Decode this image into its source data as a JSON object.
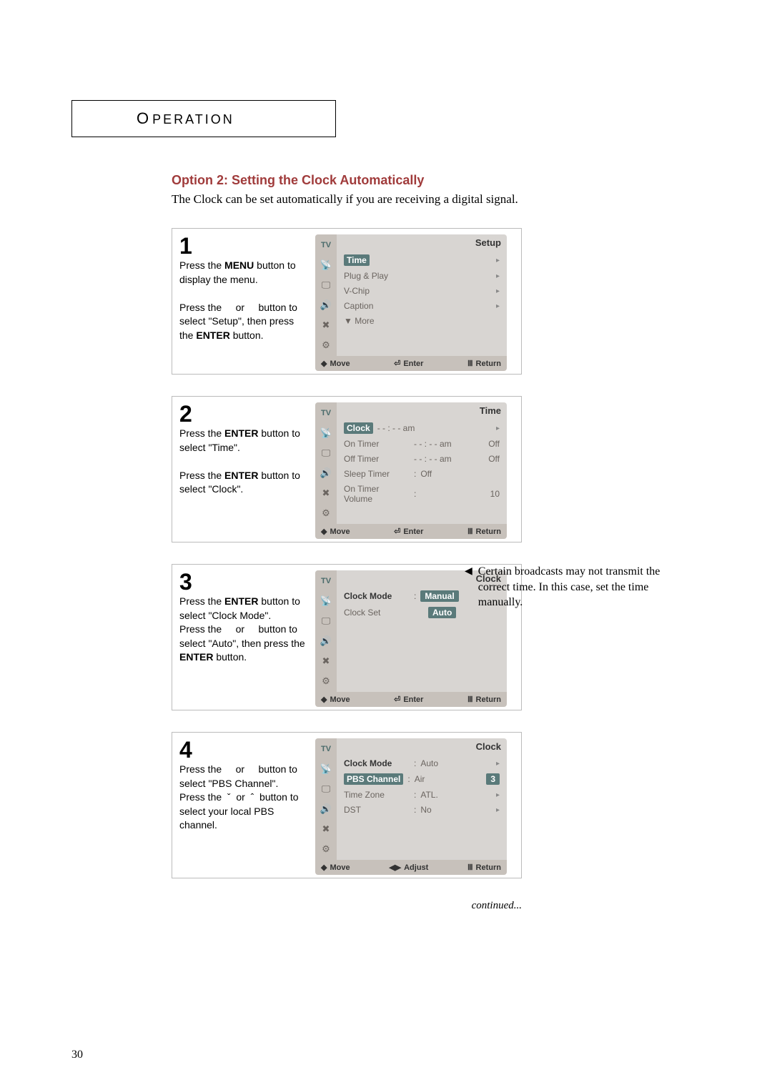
{
  "header": {
    "big": "O",
    "rest": "PERATION"
  },
  "subheading": "Option 2: Setting the Clock Automatically",
  "intro": "The Clock can be set automatically if you are receiving a digital signal.",
  "steps": [
    {
      "num": "1",
      "text_html": "Press the <strong>MENU</strong> button to display the menu.<br><br>Press the &nbsp;&nbsp;&nbsp; or &nbsp;&nbsp;&nbsp; button to select \"Setup\", then press the <strong>ENTER</strong> button.",
      "osd": {
        "title": "Setup",
        "rows": [
          {
            "label": "Time",
            "selected": true,
            "arrow": true
          },
          {
            "label": "Plug & Play",
            "dash": true
          },
          {
            "label": "V-Chip",
            "dash": true
          },
          {
            "label": "Caption",
            "dash": true
          },
          {
            "label": "▼ More",
            "more": true
          }
        ],
        "footer": [
          "Move",
          "Enter",
          "Return"
        ],
        "footer_icons": [
          "updown",
          "enter",
          "return"
        ]
      }
    },
    {
      "num": "2",
      "text_html": "Press the <strong>ENTER</strong> button to select \"Time\".<br><br>Press the <strong>ENTER</strong> button to select \"Clock\".",
      "osd": {
        "title": "Time",
        "rows": [
          {
            "label": "Clock",
            "selected": true,
            "val": "- - : - - am",
            "arrow": true
          },
          {
            "label": "On Timer",
            "val": "- - : - - am",
            "val2": "Off"
          },
          {
            "label": "Off Timer",
            "val": "- - : - - am",
            "val2": "Off"
          },
          {
            "label": "Sleep Timer",
            "colon": true,
            "val": "Off"
          },
          {
            "label": "On Timer Volume",
            "colon": true,
            "val": "10",
            "val_align_right": true
          }
        ],
        "footer": [
          "Move",
          "Enter",
          "Return"
        ],
        "footer_icons": [
          "updown",
          "enter",
          "return"
        ]
      }
    },
    {
      "num": "3",
      "text_html": "Press the <strong>ENTER</strong> button to select \"Clock Mode\".<br>Press the &nbsp;&nbsp;&nbsp; or &nbsp;&nbsp;&nbsp; button to select \"Auto\", then press the <strong>ENTER</strong> button.",
      "osd": {
        "title": "Clock",
        "rows": [
          {
            "label": "Clock Mode",
            "bold": true,
            "colon": true,
            "hl_val": "Manual"
          },
          {
            "label": "Clock Set",
            "hl_val_detached": "Auto"
          }
        ],
        "footer": [
          "Move",
          "Enter",
          "Return"
        ],
        "footer_icons": [
          "updown",
          "enter",
          "return"
        ]
      },
      "note": "Certain broadcasts may not transmit the correct time. In this case, set the time manually."
    },
    {
      "num": "4",
      "text_html": "Press the &nbsp;&nbsp;&nbsp; or &nbsp;&nbsp;&nbsp; button to select \"PBS Channel\".<br>Press the &nbsp;ˇ&nbsp; or &nbsp;ˆ&nbsp; button to select your local PBS channel.",
      "osd": {
        "title": "Clock",
        "rows": [
          {
            "label": "Clock Mode",
            "bold": true,
            "colon": true,
            "val": "Auto",
            "arrow": true
          },
          {
            "label": "PBS Channel",
            "selected": true,
            "colon": true,
            "val": "Air",
            "val2": "3",
            "val2_hl": true
          },
          {
            "label": "Time Zone",
            "colon": true,
            "val": "ATL.",
            "arrow": true
          },
          {
            "label": "DST",
            "colon": true,
            "val": "No",
            "arrow": true
          }
        ],
        "footer": [
          "Move",
          "Adjust",
          "Return"
        ],
        "footer_icons": [
          "updown",
          "leftright",
          "return"
        ]
      }
    }
  ],
  "continued": "continued...",
  "page_number": "30",
  "sidebar_icons": [
    "TV",
    "antenna",
    "monitor",
    "speaker",
    "tools",
    "sliders"
  ]
}
